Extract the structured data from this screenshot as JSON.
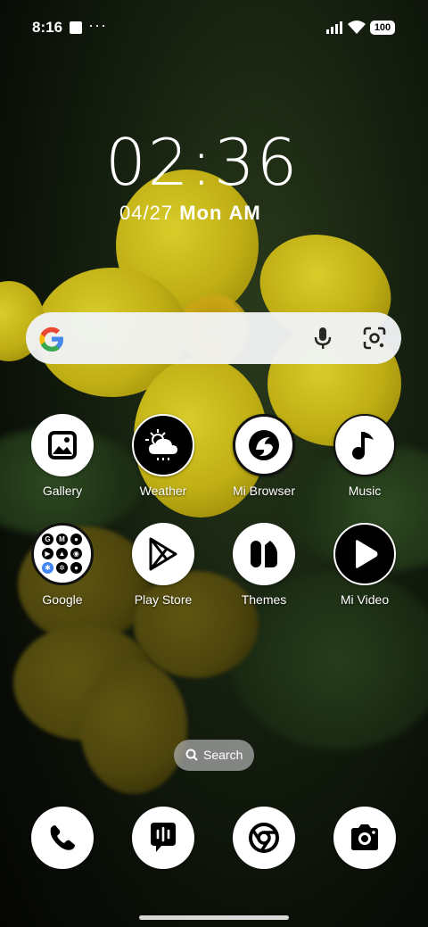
{
  "status_bar": {
    "time": "8:16",
    "overflow": "···",
    "battery": "100"
  },
  "lock_clock": {
    "time": "02:36",
    "date": "04/27",
    "weekday": "Mon",
    "ampm": "AM"
  },
  "search_pill": {
    "label": "Search"
  },
  "apps": [
    {
      "label": "Gallery",
      "icon": "gallery-icon"
    },
    {
      "label": "Weather",
      "icon": "weather-icon"
    },
    {
      "label": "Mi Browser",
      "icon": "mi-browser-icon"
    },
    {
      "label": "Music",
      "icon": "music-icon"
    },
    {
      "label": "Google",
      "icon": "google-folder-icon"
    },
    {
      "label": "Play Store",
      "icon": "play-store-icon"
    },
    {
      "label": "Themes",
      "icon": "themes-icon"
    },
    {
      "label": "Mi Video",
      "icon": "mi-video-icon"
    }
  ],
  "dock": [
    {
      "icon": "phone-icon"
    },
    {
      "icon": "messages-icon"
    },
    {
      "icon": "chrome-icon"
    },
    {
      "icon": "camera-icon"
    }
  ],
  "colors": {
    "wallpaper_flower": "#c9b81a",
    "search_bar": "#f1f3f4"
  }
}
